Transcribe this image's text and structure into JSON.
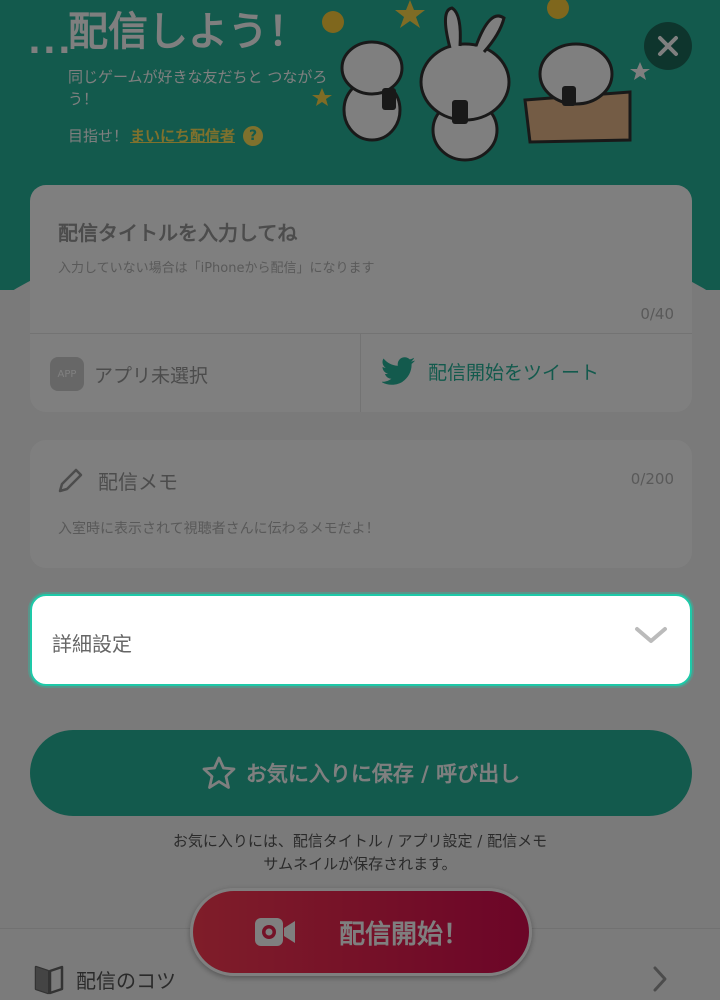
{
  "header": {
    "dots": "...",
    "title": "配信しよう！",
    "subtitle": "同じゲームが好きな友だちと つながろう！",
    "target_prefix": "目指せ！",
    "target_link": "まいにち配信者",
    "help": "?"
  },
  "title_card": {
    "placeholder": "配信タイトルを入力してね",
    "hint": "入力していない場合は「iPhoneから配信」になります",
    "count": "0/40",
    "app_badge": "APP",
    "app_label": "アプリ未選択",
    "tweet_label": "配信開始をツイート"
  },
  "memo_card": {
    "label": "配信メモ",
    "count": "0/200",
    "hint": "入室時に表示されて視聴者さんに伝わるメモだよ！"
  },
  "settings": {
    "label": "詳細設定"
  },
  "favorites": {
    "button_label": "お気に入りに保存 / 呼び出し",
    "note_line1": "お気に入りには、配信タイトル / アプリ設定 / 配信メモ",
    "note_line2": "サムネイルが保存されます。"
  },
  "start": {
    "label": "配信開始！"
  },
  "tips": {
    "label": "配信のコツ"
  },
  "colors": {
    "accent": "#26b59a",
    "start_gradient_from": "#ff3b53",
    "start_gradient_to": "#d80b4f",
    "link": "#ffe25a"
  }
}
